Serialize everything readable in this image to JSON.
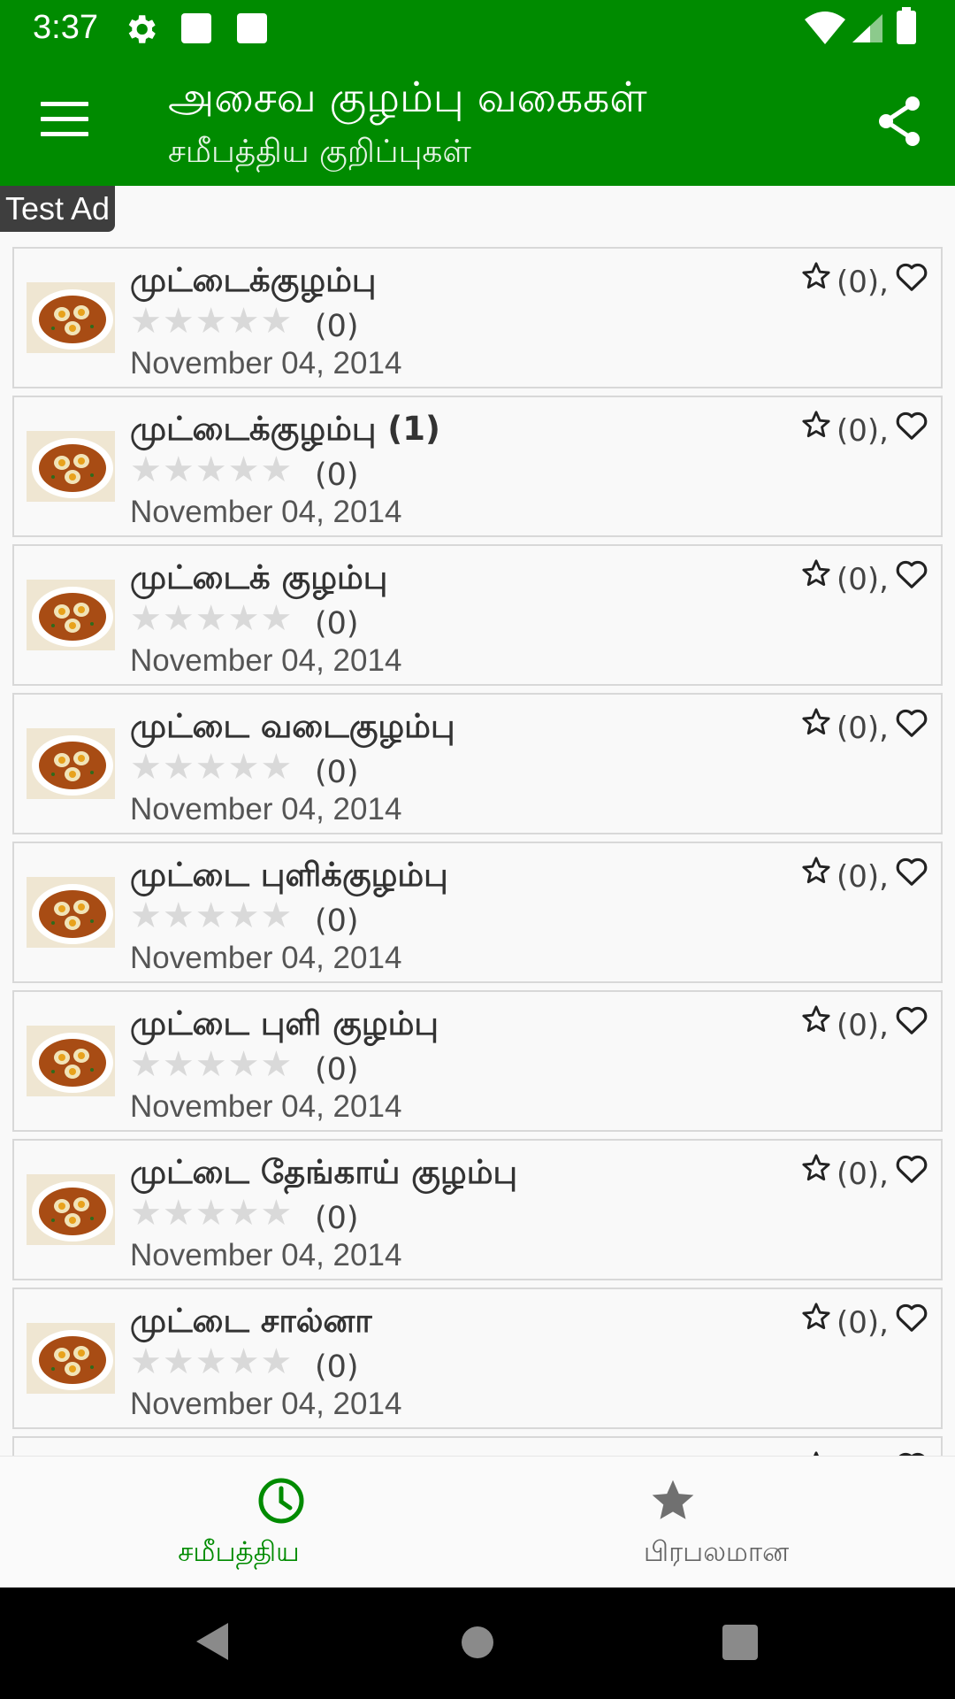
{
  "status_bar": {
    "time": "3:37",
    "icons": [
      "gear-icon",
      "notification-square-icon",
      "notification-square-icon",
      "wifi-icon",
      "signal-icon",
      "battery-icon"
    ]
  },
  "app_bar": {
    "title": "அசைவ குழம்பு வகைகள்",
    "subtitle": "சமீபத்திய குறிப்புகள்",
    "menu_icon": "menu-icon",
    "share_icon": "share-icon"
  },
  "ad": {
    "label": "Test Ad"
  },
  "list": {
    "items": [
      {
        "title": "முட்டைக்குழம்பு",
        "rating_count": "(0)",
        "date": "November 04, 2014",
        "fav_count": "(0),",
        "rating": 0
      },
      {
        "title": "முட்டைக்குழம்பு (1)",
        "rating_count": "(0)",
        "date": "November 04, 2014",
        "fav_count": "(0),",
        "rating": 0
      },
      {
        "title": "முட்டைக் குழம்பு",
        "rating_count": "(0)",
        "date": "November 04, 2014",
        "fav_count": "(0),",
        "rating": 0
      },
      {
        "title": "முட்டை வடைகுழம்பு",
        "rating_count": "(0)",
        "date": "November 04, 2014",
        "fav_count": "(0),",
        "rating": 0
      },
      {
        "title": "முட்டை புளிக்குழம்பு",
        "rating_count": "(0)",
        "date": "November 04, 2014",
        "fav_count": "(0),",
        "rating": 0
      },
      {
        "title": "முட்டை புளி குழம்பு",
        "rating_count": "(0)",
        "date": "November 04, 2014",
        "fav_count": "(0),",
        "rating": 0
      },
      {
        "title": "முட்டை தேங்காய் குழம்பு",
        "rating_count": "(0)",
        "date": "November 04, 2014",
        "fav_count": "(0),",
        "rating": 0
      },
      {
        "title": "முட்டை சால்னா",
        "rating_count": "(0)",
        "date": "November 04, 2014",
        "fav_count": "(0),",
        "rating": 0
      },
      {
        "title": "",
        "rating_count": "",
        "date": "",
        "fav_count": "",
        "rating": 0
      }
    ]
  },
  "bottom_nav": {
    "recent_label": "சமீபத்திய",
    "popular_label": "பிரபலமான",
    "active_color": "#008b00",
    "inactive_color": "#666666"
  },
  "colors": {
    "brand": "#008b00"
  }
}
